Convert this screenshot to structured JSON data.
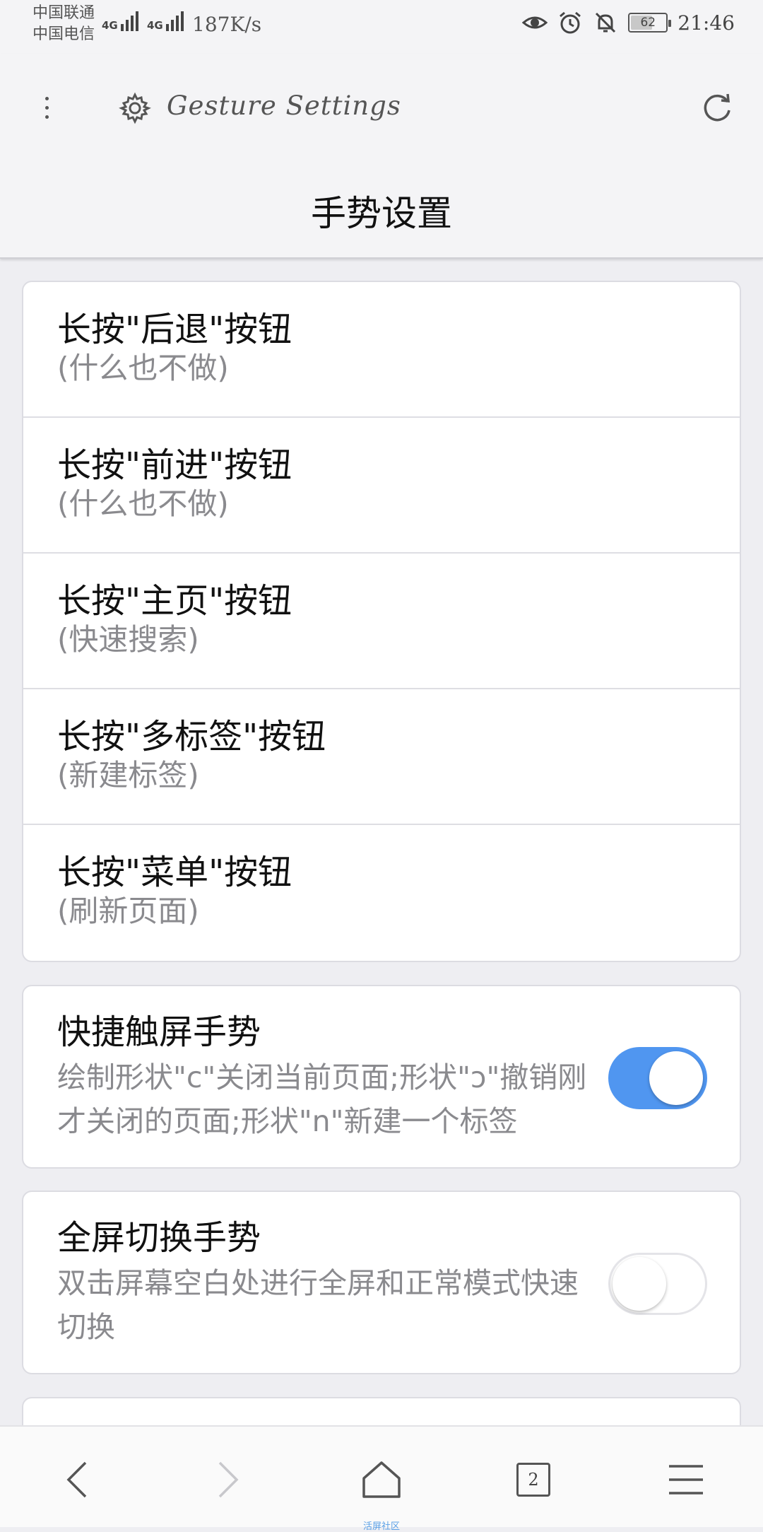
{
  "status_bar": {
    "carrier_1": "中国联通",
    "carrier_2": "中国电信",
    "net_type_1": "4G",
    "net_type_2": "4G",
    "speed": "187K/s",
    "battery": "62",
    "battery_level": 0.62,
    "time": "21:46",
    "icons": [
      "eye-icon",
      "alarm-icon",
      "bell-off-icon"
    ]
  },
  "app_bar": {
    "tab_title": "Gesture Settings",
    "page_title": "手势设置"
  },
  "long_press_items": [
    {
      "title": "长按\"后退\"按钮",
      "value": "(什么也不做)"
    },
    {
      "title": "长按\"前进\"按钮",
      "value": "(什么也不做)"
    },
    {
      "title": "长按\"主页\"按钮",
      "value": "(快速搜索)"
    },
    {
      "title": "长按\"多标签\"按钮",
      "value": "(新建标签)"
    },
    {
      "title": "长按\"菜单\"按钮",
      "value": "(刷新页面)"
    }
  ],
  "quick_gesture": {
    "title": "快捷触屏手势",
    "description": "绘制形状\"c\"关闭当前页面;形状\"ɔ\"撤销刚才关闭的页面;形状\"n\"新建一个标签",
    "enabled": true
  },
  "fullscreen_gesture": {
    "title": "全屏切换手势",
    "description": "双击屏幕空白处进行全屏和正常模式快速切换",
    "enabled": false
  },
  "accent_color": "#5096f0",
  "bottom_nav": {
    "tab_count": "2",
    "watermark": "活屏社区"
  }
}
